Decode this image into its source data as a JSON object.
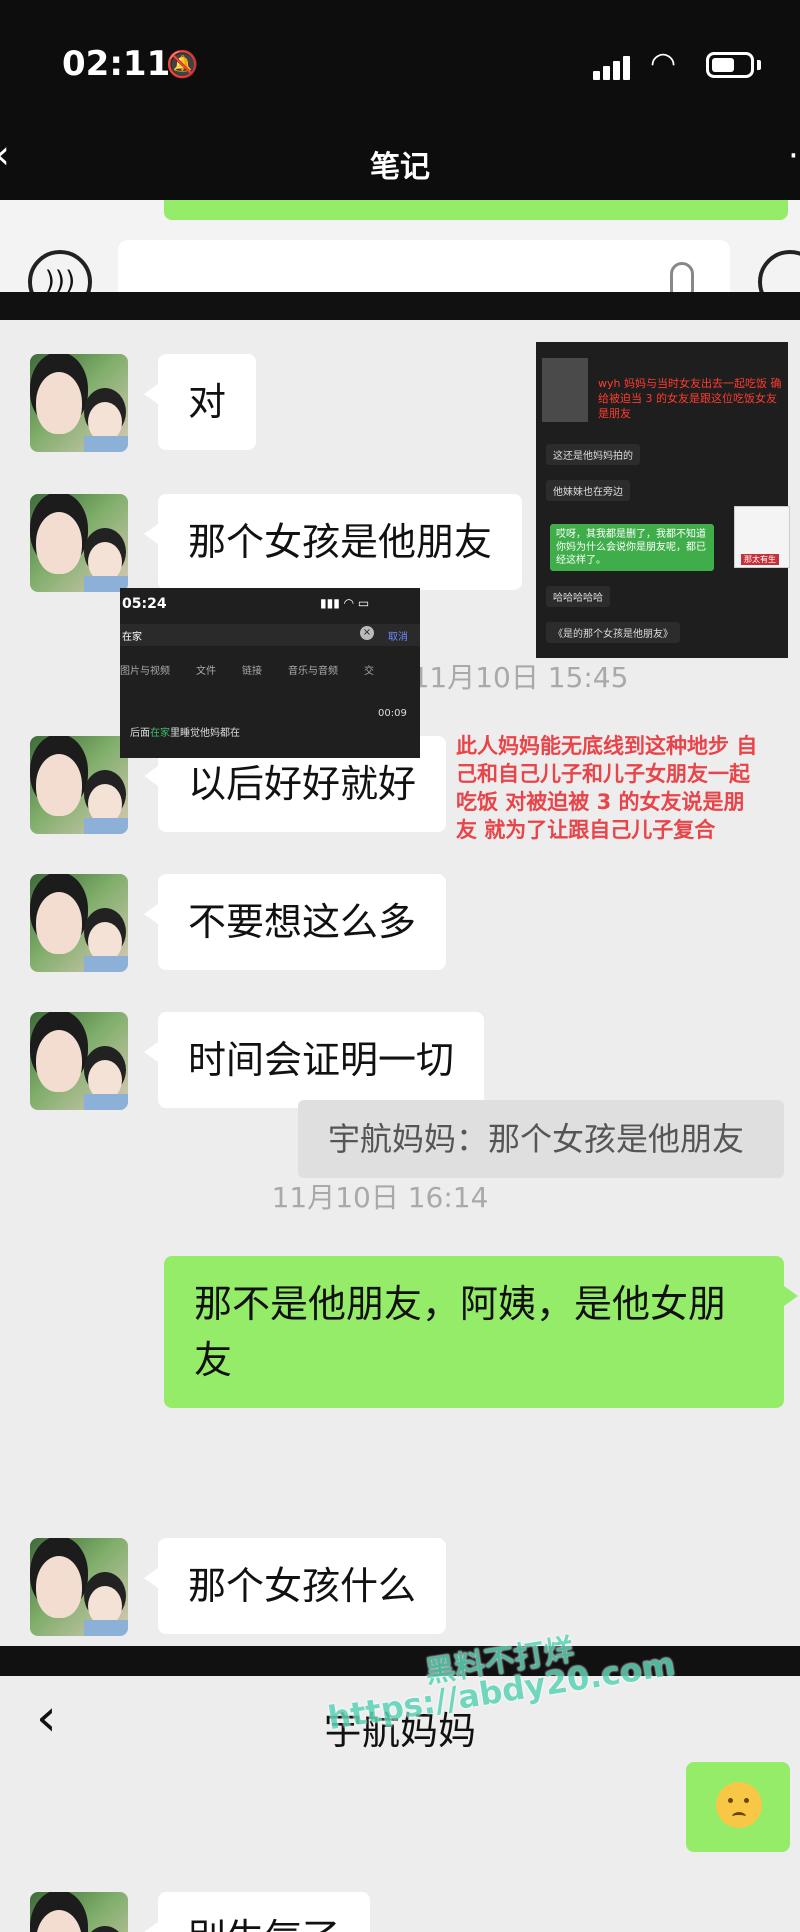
{
  "status_bar": {
    "time": "02:11"
  },
  "top_title": "笔记",
  "chat": {
    "messages": [
      {
        "text": "对"
      },
      {
        "text": "那个女孩是他朋友"
      },
      {
        "text": "以后好好就好"
      },
      {
        "text": "不要想这么多"
      },
      {
        "text": "时间会证明一切"
      },
      {
        "text": "那不是他朋友，阿姨，是他女朋友"
      },
      {
        "text": "那个女孩什么"
      }
    ],
    "timestamps": [
      "11月10日 15:45",
      "11月10日 16:14"
    ],
    "quote": "宇航妈妈：那个女孩是他朋友"
  },
  "inset_screenshot_1": {
    "red_text": "wyh 妈妈与当时女友出去一起吃饭 确给被迫当 3 的女友是跟这位吃饭女友是朋友",
    "msg1": "这还是他妈妈拍的",
    "msg2": "他妹妹也在旁边",
    "green_msg": "哎呀，其我都是删了，我都不知道你妈为什么会说你是朋友呢，都已经这样了。",
    "meme_caption": "那太有生",
    "msg3": "哈哈哈哈哈",
    "msg4": "《是的那个女孩是他朋友》"
  },
  "inset_screenshot_2": {
    "time": "05:24",
    "search_text": "在家",
    "cancel": "取消",
    "tabs": [
      "图片与视频",
      "文件",
      "链接",
      "音乐与音频",
      "交"
    ],
    "duration": "00:09",
    "result_prefix": "后面",
    "result_highlight": "在家",
    "result_suffix": "里睡觉他妈都在"
  },
  "annotation": "此人妈妈能无底线到这种地步 自己和自己儿子和儿子女朋友一起吃饭 对被迫被 3 的女友说是朋友 就为了让跟自己儿子复合",
  "second_screen": {
    "contact_name": "宇航妈妈",
    "partial_message": "别生气了"
  },
  "watermark": {
    "line1": "黑料不打烊",
    "line2": "https://abdy20.com"
  }
}
